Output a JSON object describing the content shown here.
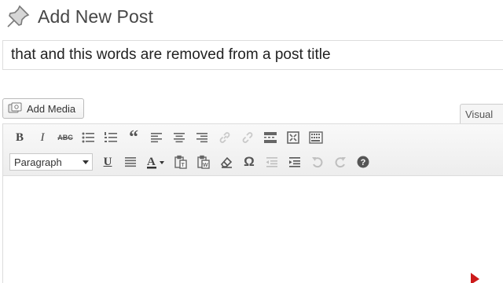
{
  "header": {
    "title": "Add New Post",
    "icon": "pushpin-icon"
  },
  "post": {
    "title_value": "that and this words are removed from a post title"
  },
  "media": {
    "add_label": "Add Media",
    "icon": "media-camera-icon"
  },
  "tabs": {
    "visual_label": "Visual"
  },
  "toolbar": {
    "bold": "B",
    "italic": "I",
    "strike": "ABC",
    "blockquote": "“",
    "underline": "U",
    "omega": "Ω",
    "format_selected": "Paragraph"
  },
  "colors": {
    "accent_cursor": "#cc1a1a",
    "border": "#dddddd",
    "toolbar_bg": "#f1f1f1"
  }
}
